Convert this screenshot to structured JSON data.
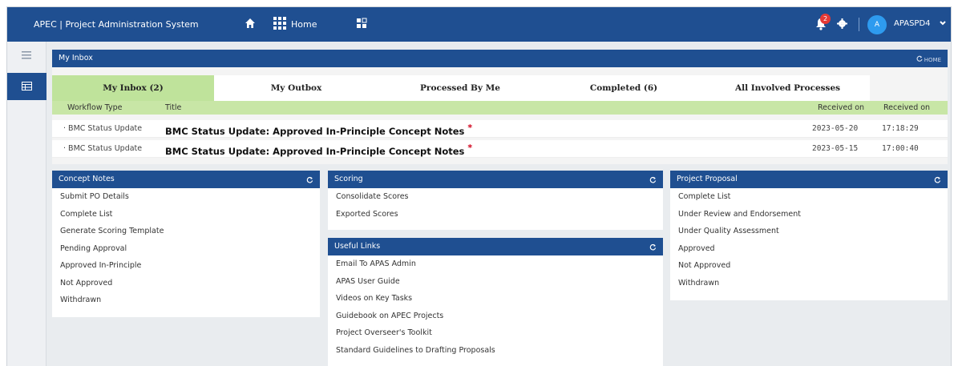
{
  "topbar": {
    "app_title": "APEC | Project Administration System",
    "home_label": "Home",
    "notification_count": "2",
    "avatar_initial": "A",
    "username": "APASPD4"
  },
  "inbox": {
    "title": "My Inbox",
    "tools_label": "HOME",
    "tabs": [
      {
        "label": "My Inbox (2)",
        "active": true
      },
      {
        "label": "My Outbox",
        "active": false
      },
      {
        "label": "Processed By Me",
        "active": false
      },
      {
        "label": "Completed (6)",
        "active": false
      },
      {
        "label": "All Involved Processes",
        "active": false
      }
    ],
    "columns": {
      "workflow_type": "Workflow Type",
      "title": "Title",
      "received_on_date": "Received on",
      "received_on_time": "Received on"
    },
    "rows": [
      {
        "workflow_type": "BMC Status Update",
        "title": "BMC Status Update: Approved In-Principle Concept Notes",
        "date": "2023-05-20",
        "time": "17:18:29"
      },
      {
        "workflow_type": "BMC Status Update",
        "title": "BMC Status Update: Approved In-Principle Concept Notes",
        "date": "2023-05-15",
        "time": "17:00:40"
      }
    ],
    "required_marker": "*"
  },
  "concept_notes": {
    "title": "Concept Notes",
    "items": [
      "Submit PO Details",
      "Complete List",
      "Generate Scoring Template",
      "Pending Approval",
      "Approved In-Principle",
      "Not Approved",
      "Withdrawn"
    ]
  },
  "scoring": {
    "title": "Scoring",
    "items": [
      "Consolidate Scores",
      "Exported Scores"
    ]
  },
  "useful_links": {
    "title": "Useful Links",
    "items": [
      "Email To APAS Admin",
      "APAS User Guide",
      "Videos on Key Tasks",
      "Guidebook on APEC Projects",
      "Project Overseer's Toolkit",
      "Standard Guidelines to Drafting Proposals"
    ]
  },
  "project_proposal": {
    "title": "Project Proposal",
    "items": [
      "Complete List",
      "Under Review and Endorsement",
      "Under Quality Assessment",
      "Approved",
      "Not Approved",
      "Withdrawn"
    ]
  },
  "colors": {
    "primary": "#1f4f91",
    "tab_active": "#bfe39b",
    "table_header": "#c8e6a6",
    "badge": "#e53935",
    "avatar": "#2e9bef",
    "required": "#d0021b"
  },
  "icons": [
    "home-icon",
    "apps-icon",
    "grid-icon",
    "bell-icon",
    "gear-icon",
    "chevron-down-icon",
    "menu-icon",
    "table-icon",
    "refresh-icon"
  ]
}
